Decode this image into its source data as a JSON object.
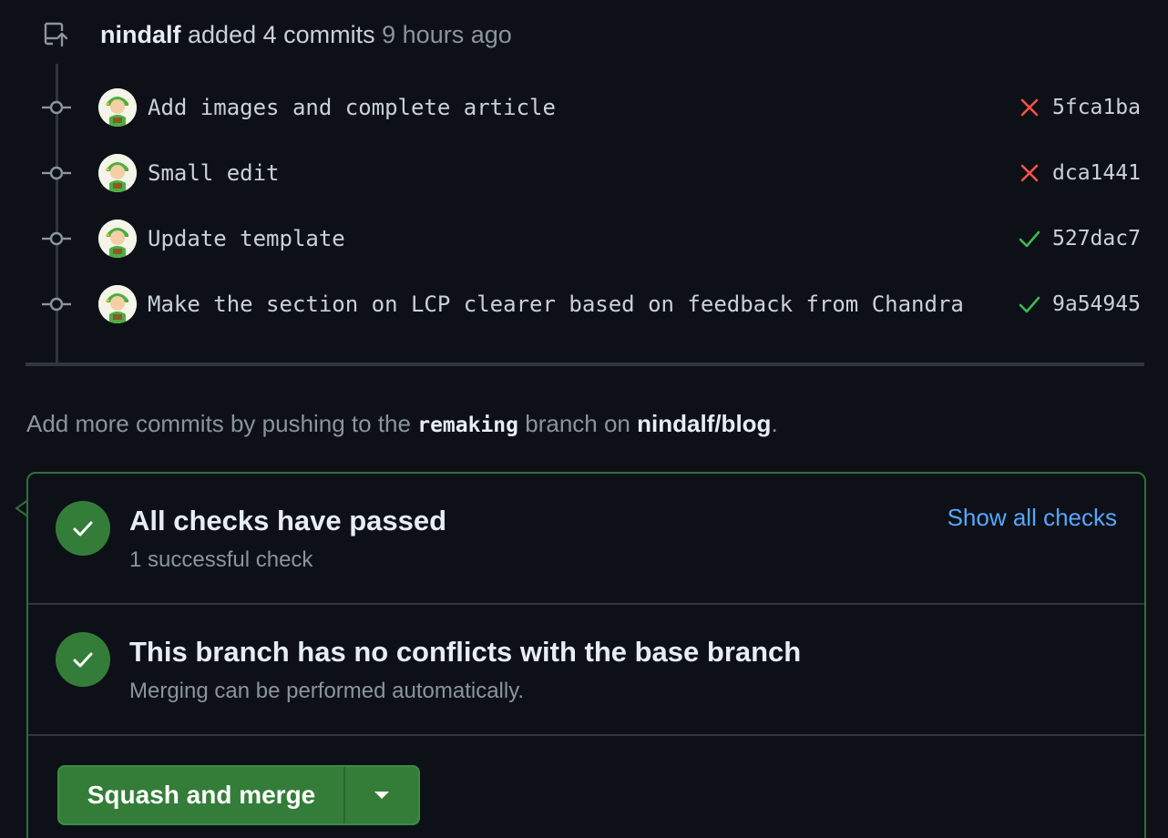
{
  "event": {
    "actor": "nindalf",
    "action": "added 4 commits",
    "time": "9 hours ago"
  },
  "commits": [
    {
      "message": "Add images and complete article",
      "status": "failure",
      "sha": "5fca1ba"
    },
    {
      "message": "Small edit",
      "status": "failure",
      "sha": "dca1441"
    },
    {
      "message": "Update template",
      "status": "success",
      "sha": "527dac7"
    },
    {
      "message": "Make the section on LCP clearer based on feedback from Chandra",
      "status": "success",
      "sha": "9a54945"
    }
  ],
  "hint": {
    "prefix": "Add more commits by pushing to the",
    "branch": "remaking",
    "middle": "branch on",
    "repo": "nindalf/blog",
    "suffix": "."
  },
  "checks": {
    "title": "All checks have passed",
    "subtitle": "1 successful check",
    "show_all_label": "Show all checks"
  },
  "conflicts": {
    "title": "This branch has no conflicts with the base branch",
    "subtitle": "Merging can be performed automatically."
  },
  "merge": {
    "button_label": "Squash and merge"
  },
  "colors": {
    "success": "#3fb950",
    "failure": "#f85149",
    "link": "#58a6ff",
    "merge_green": "#347d39"
  }
}
